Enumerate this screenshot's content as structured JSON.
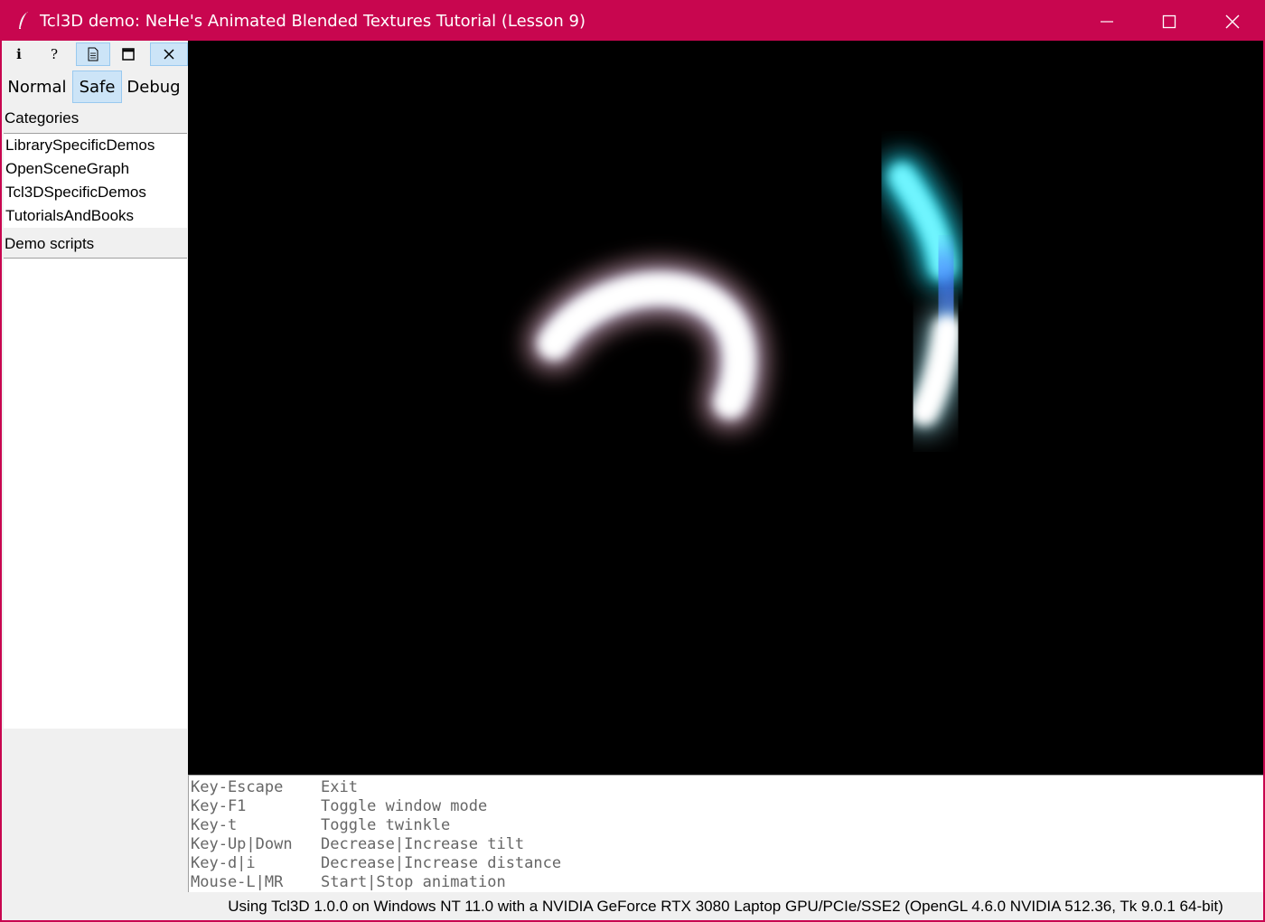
{
  "window": {
    "title": "Tcl3D demo: NeHe's Animated Blended Textures Tutorial (Lesson 9)",
    "accent": "#c8064f"
  },
  "toolbar": {
    "info_label": "i",
    "help_label": "?",
    "icons": [
      "info-icon",
      "help-icon",
      "document-icon",
      "window-icon",
      "close-icon"
    ]
  },
  "modes": {
    "normal": "Normal",
    "safe": "Safe",
    "debug": "Debug",
    "selected": "Safe"
  },
  "categories": {
    "label": "Categories",
    "items": [
      "LibrarySpecificDemos",
      "OpenSceneGraph",
      "Tcl3DSpecificDemos",
      "TutorialsAndBooks"
    ]
  },
  "demo_scripts": {
    "label": "Demo scripts",
    "items": []
  },
  "help": {
    "rows": [
      {
        "key": "Key-Escape",
        "action": "Exit"
      },
      {
        "key": "Key-F1",
        "action": "Toggle window mode"
      },
      {
        "key": "Key-t",
        "action": "Toggle twinkle"
      },
      {
        "key": "Key-Up|Down",
        "action": "Decrease|Increase tilt"
      },
      {
        "key": "Key-d|i",
        "action": "Decrease|Increase distance"
      },
      {
        "key": "Mouse-L|MR",
        "action": "Start|Stop animation"
      }
    ]
  },
  "status": {
    "text": "Using Tcl3D 1.0.0 on Windows NT 11.0 with a NVIDIA GeForce RTX 3080 Laptop GPU/PCIe/SSE2 (OpenGL 4.6.0 NVIDIA 512.36, Tk 9.0.1 64-bit)"
  }
}
